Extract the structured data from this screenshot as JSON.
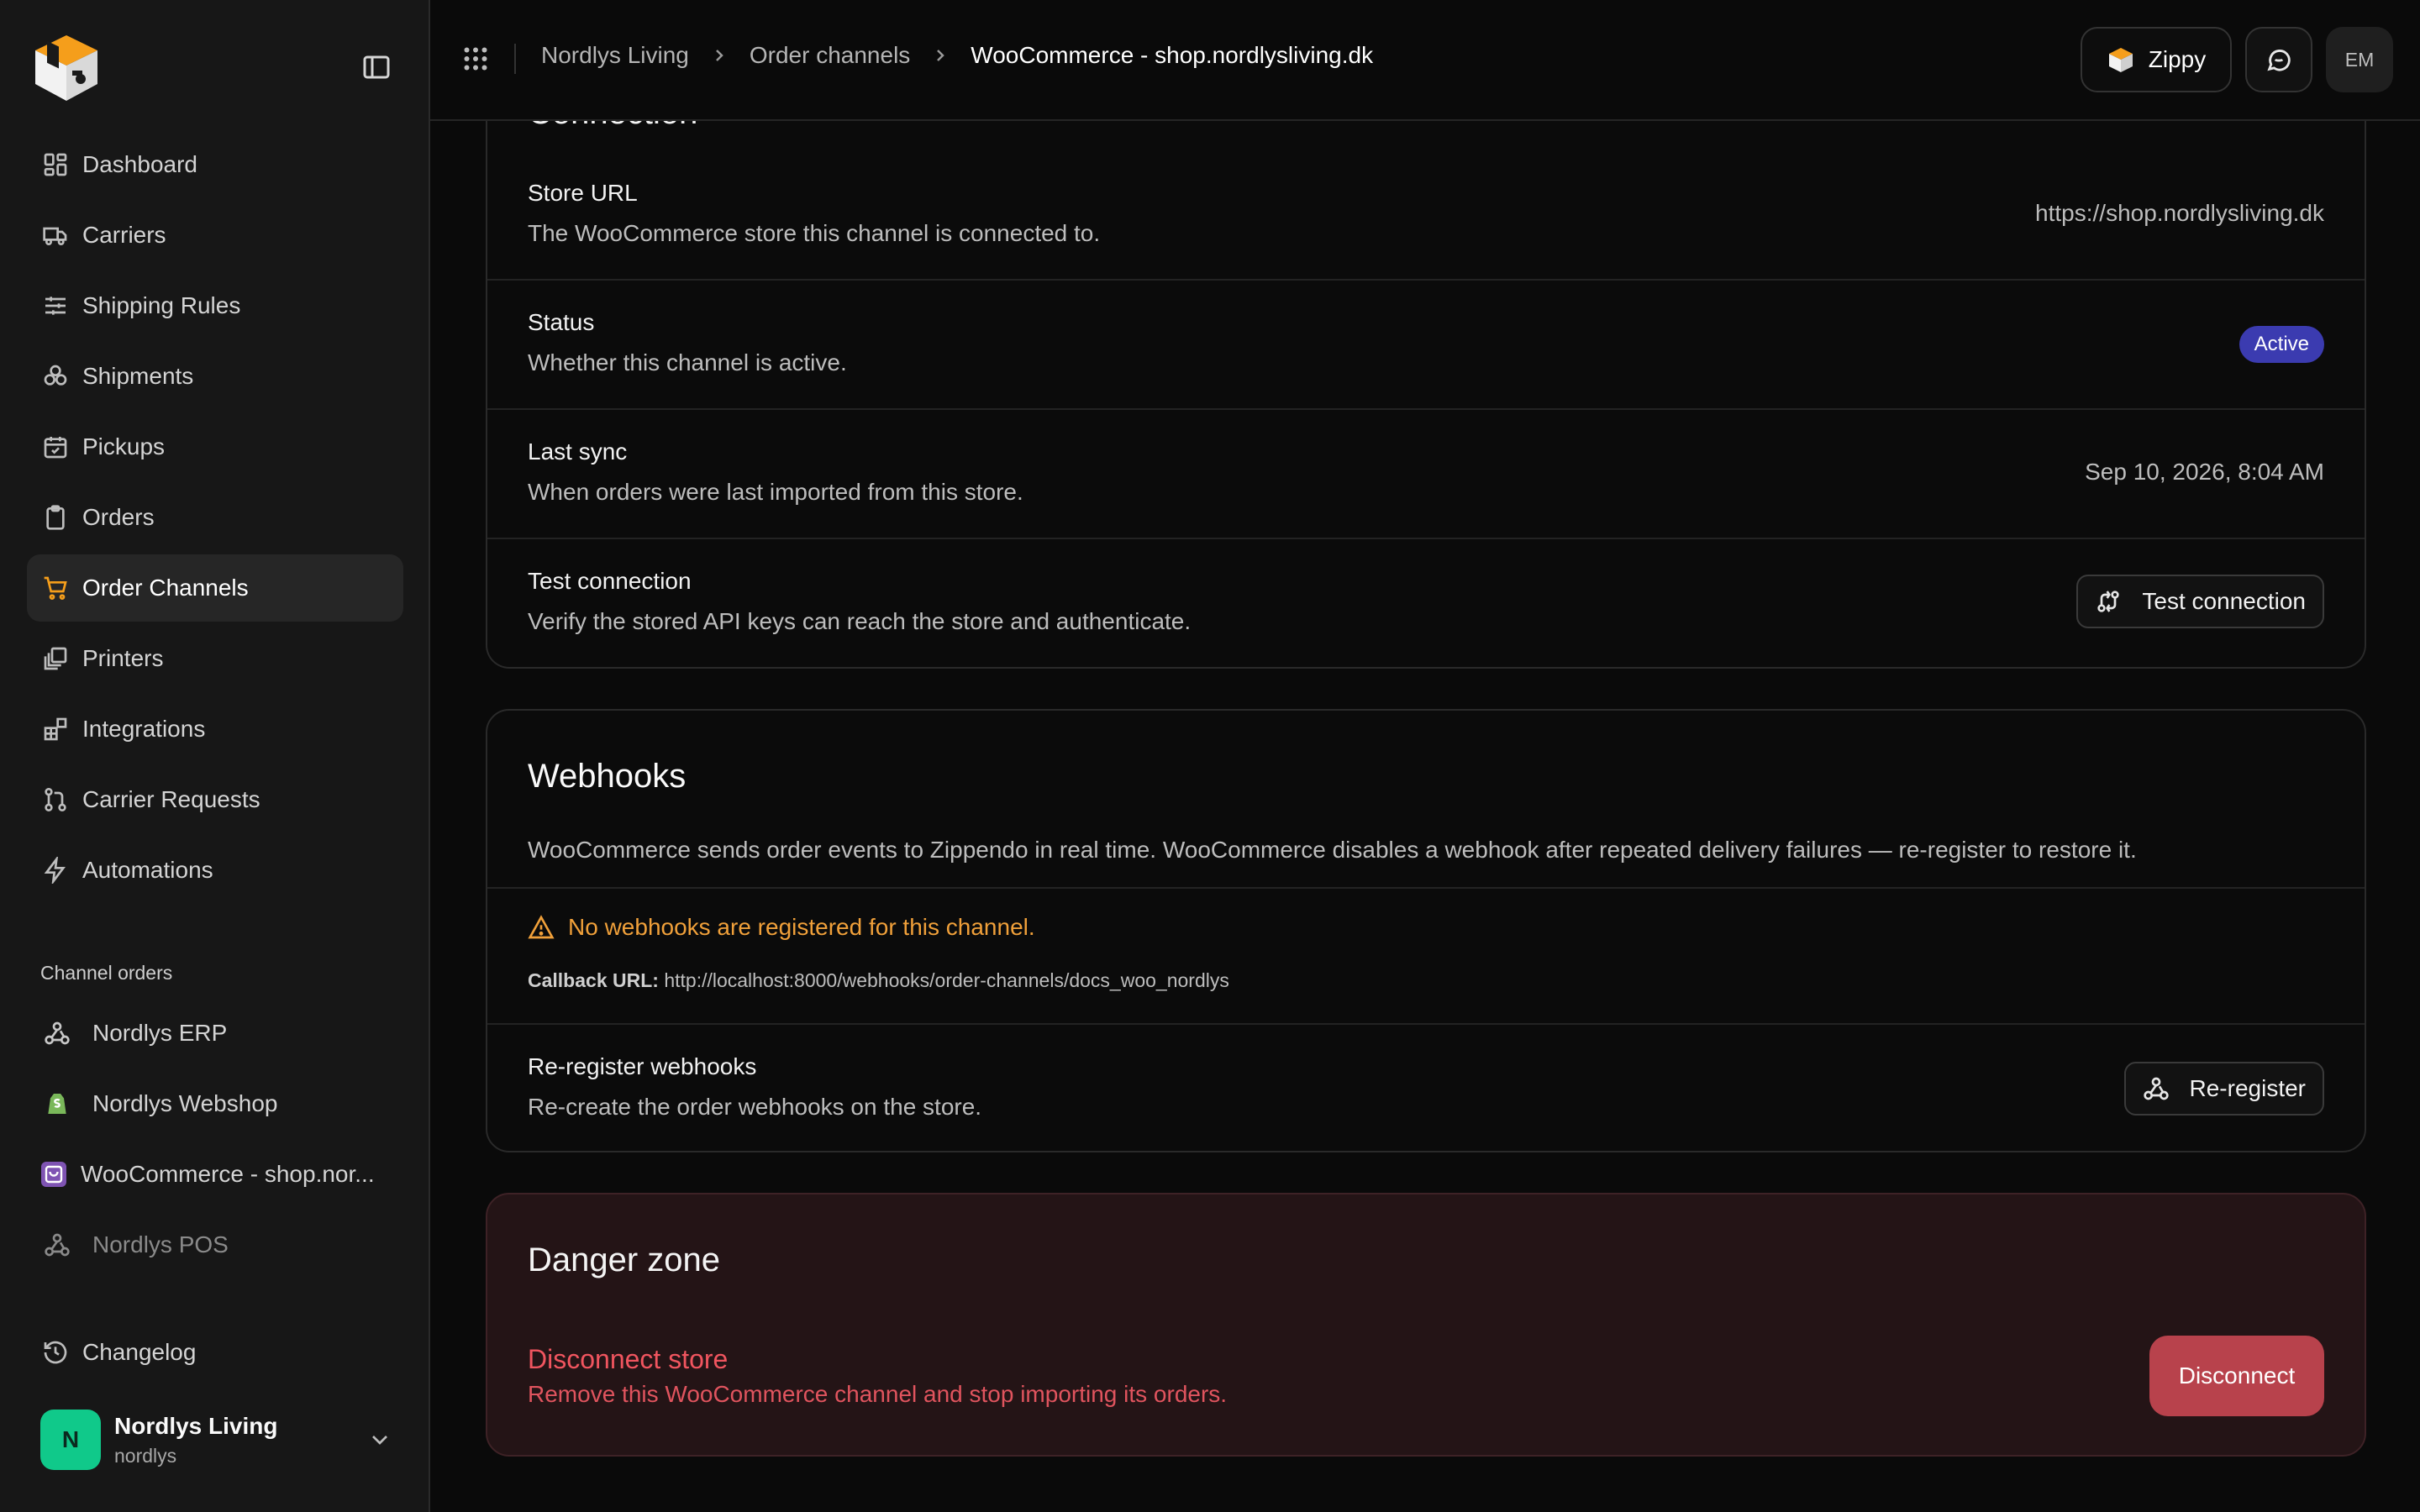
{
  "colors": {
    "accent": "#f59e1b",
    "active_badge": "#3b3bb0",
    "danger": "#b8424c",
    "org_avatar": "#10c98a"
  },
  "sidebar": {
    "items": [
      {
        "label": "Dashboard",
        "icon": "dashboard-icon"
      },
      {
        "label": "Carriers",
        "icon": "truck-icon"
      },
      {
        "label": "Shipping Rules",
        "icon": "sliders-icon"
      },
      {
        "label": "Shipments",
        "icon": "boxes-icon"
      },
      {
        "label": "Pickups",
        "icon": "calendar-check-icon"
      },
      {
        "label": "Orders",
        "icon": "clipboard-icon"
      },
      {
        "label": "Order Channels",
        "icon": "cart-icon"
      },
      {
        "label": "Printers",
        "icon": "printer-icon"
      },
      {
        "label": "Integrations",
        "icon": "blocks-icon"
      },
      {
        "label": "Carrier Requests",
        "icon": "git-pull-icon"
      },
      {
        "label": "Automations",
        "icon": "zap-icon"
      }
    ],
    "channel_section_label": "Channel orders",
    "channels": [
      {
        "label": "Nordlys ERP",
        "icon": "webhook-icon"
      },
      {
        "label": "Nordlys Webshop",
        "icon": "shopify-icon"
      },
      {
        "label": "WooCommerce - shop.nor...",
        "icon": "woocommerce-icon"
      },
      {
        "label": "Nordlys POS",
        "icon": "webhook-icon"
      }
    ],
    "changelog": "Changelog",
    "org": {
      "initial": "N",
      "name": "Nordlys Living",
      "slug": "nordlys"
    }
  },
  "header": {
    "breadcrumbs": [
      "Nordlys Living",
      "Order channels",
      "WooCommerce - shop.nordlysliving.dk"
    ],
    "zippy_label": "Zippy",
    "user_initials": "EM"
  },
  "connection": {
    "title": "Connection",
    "rows": {
      "store_url": {
        "title": "Store URL",
        "desc": "The WooCommerce store this channel is connected to.",
        "value": "https://shop.nordlysliving.dk"
      },
      "status": {
        "title": "Status",
        "desc": "Whether this channel is active.",
        "value": "Active"
      },
      "last_sync": {
        "title": "Last sync",
        "desc": "When orders were last imported from this store.",
        "value": "Sep 10, 2026, 8:04 AM"
      },
      "test": {
        "title": "Test connection",
        "desc": "Verify the stored API keys can reach the store and authenticate.",
        "button": "Test connection"
      }
    }
  },
  "webhooks": {
    "title": "Webhooks",
    "desc": "WooCommerce sends order events to Zippendo in real time. WooCommerce disables a webhook after repeated delivery failures — re-register to restore it.",
    "warning": "No webhooks are registered for this channel.",
    "callback_label": "Callback URL:",
    "callback_url": "http://localhost:8000/webhooks/order-channels/docs_woo_nordlys",
    "reregister_title": "Re-register webhooks",
    "reregister_desc": "Re-create the order webhooks on the store.",
    "reregister_button": "Re-register"
  },
  "danger": {
    "title": "Danger zone",
    "row_title": "Disconnect store",
    "row_desc": "Remove this WooCommerce channel and stop importing its orders.",
    "button": "Disconnect"
  }
}
